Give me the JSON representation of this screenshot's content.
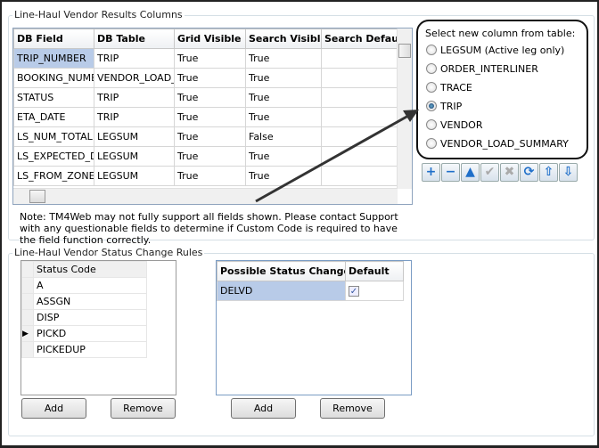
{
  "results_group": {
    "title": "Line-Haul Vendor Results Columns",
    "columns": [
      "DB Field",
      "DB Table",
      "Grid Visible",
      "Search Visible",
      "Search Default"
    ],
    "rows": [
      [
        "TRIP_NUMBER",
        "TRIP",
        "True",
        "True",
        ""
      ],
      [
        "BOOKING_NUMB",
        "VENDOR_LOAD_",
        "True",
        "True",
        ""
      ],
      [
        "STATUS",
        "TRIP",
        "True",
        "True",
        ""
      ],
      [
        "ETA_DATE",
        "TRIP",
        "True",
        "True",
        ""
      ],
      [
        "LS_NUM_TOTAL",
        "LEGSUM",
        "True",
        "False",
        ""
      ],
      [
        "LS_EXPECTED_D",
        "LEGSUM",
        "True",
        "True",
        ""
      ],
      [
        "LS_FROM_ZONE",
        "LEGSUM",
        "True",
        "True",
        ""
      ]
    ],
    "note": "Note: TM4Web may not fully support all fields shown. Please contact Support with any questionable fields to determine if Custom Code is required to have the field function correctly."
  },
  "table_select": {
    "title": "Select new column from table:",
    "options": [
      "LEGSUM (Active leg only)",
      "ORDER_INTERLINER",
      "TRACE",
      "TRIP",
      "VENDOR",
      "VENDOR_LOAD_SUMMARY"
    ],
    "selected": "TRIP"
  },
  "toolbar": {
    "icons": [
      "add-icon",
      "remove-icon",
      "move-up-icon",
      "accept-icon",
      "cancel-icon",
      "refresh-icon",
      "move-top-icon",
      "move-bottom-icon"
    ]
  },
  "status_group": {
    "title": "Line-Haul Vendor Status Change Rules",
    "status_header": "Status Code",
    "status_codes": [
      "A",
      "ASSGN",
      "DISP",
      "PICKD",
      "PICKEDUP"
    ],
    "current_status": "PICKD",
    "change_headers": [
      "Possible Status Change",
      "Default"
    ],
    "changes": [
      {
        "status": "DELVD",
        "default": true
      }
    ],
    "add_label": "Add",
    "remove_label": "Remove"
  }
}
